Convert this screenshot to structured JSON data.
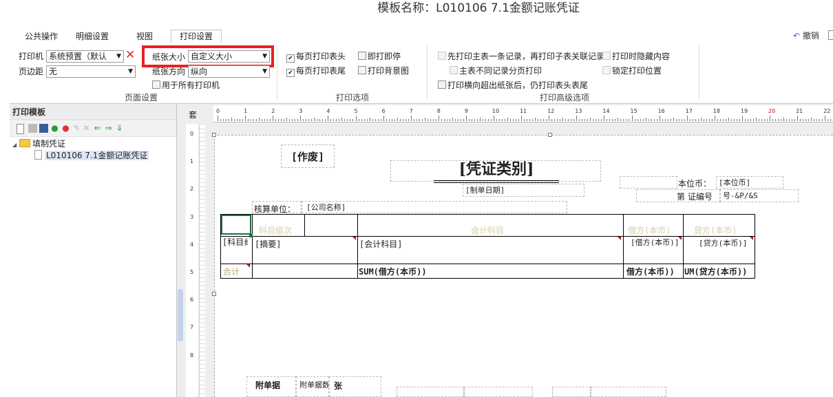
{
  "title": "模板名称：L010106 7.1金额记账凭证",
  "tabs": [
    "公共操作",
    "明细设置",
    "视图",
    "打印设置"
  ],
  "undo_label": "撤销",
  "page_setup": {
    "printer_label": "打印机",
    "printer_value": "系统预置（默认",
    "margin_label": "页边距",
    "margin_value": "无",
    "paper_size_label": "纸张大小",
    "paper_size_value": "自定义大小",
    "orientation_label": "纸张方向",
    "orientation_value": "纵向",
    "all_printers_label": "用于所有打印机",
    "group_title": "页面设置"
  },
  "print_options": {
    "header_each_page": "每页打印表头",
    "footer_each_page": "每页打印表尾",
    "print_and_stop": "即打即停",
    "print_background": "打印背景图",
    "group_title": "打印选项"
  },
  "advanced": {
    "opt1": "先打印主表一条记录，再打印子表关联记录",
    "opt2": "打印时隐藏内容",
    "opt3": "主表不同记录分页打印",
    "opt4": "锁定打印位置",
    "opt5": "打印横向超出纸张后，仍打印表头表尾",
    "group_title": "打印高级选项"
  },
  "left_panel": {
    "header": "打印模板",
    "tree_root": "填制凭证",
    "tree_child": "L010106 7.1金额记账凭证"
  },
  "designer": {
    "corner": "套",
    "ruler_top": [
      "0",
      "1",
      "2",
      "3",
      "4",
      "5",
      "6",
      "7",
      "8",
      "9",
      "10",
      "11",
      "12",
      "13",
      "14",
      "15",
      "16",
      "17",
      "18",
      "19",
      "20",
      "21",
      "22"
    ],
    "ruler_left": [
      "0",
      "1",
      "2",
      "3",
      "4",
      "5",
      "6",
      "7",
      "8"
    ],
    "void_label": "[作废]",
    "voucher_type": "[凭证类别]",
    "date_field": "[制单日期]",
    "currency_label": "本位币：",
    "currency_field": "[本位币]",
    "voucher_no_label": "第",
    "voucher_no_label2": "证编号",
    "voucher_no_field": "号-&P/&S",
    "unit_label": "核算单位：",
    "company_field": "[公司名称]",
    "col_level": "科目级次",
    "col_account": "会计科目",
    "col_debit": "借方(本币)",
    "col_credit": "贷方(本币)",
    "row_subject": "[科目纟",
    "row_summary": "[摘要]",
    "row_account": "[会计科目]",
    "row_debit": "[借方(本币)]",
    "row_credit": "[贷方(本币)]",
    "total_label": "合计",
    "sum_debit": "SUM(借方(本币))",
    "sum_debit2": "借方(本币))",
    "sum_credit": "UM(贷方(本币))",
    "attach_label": "附单据",
    "attach_field": "附单据数",
    "attach_unit": "张"
  }
}
